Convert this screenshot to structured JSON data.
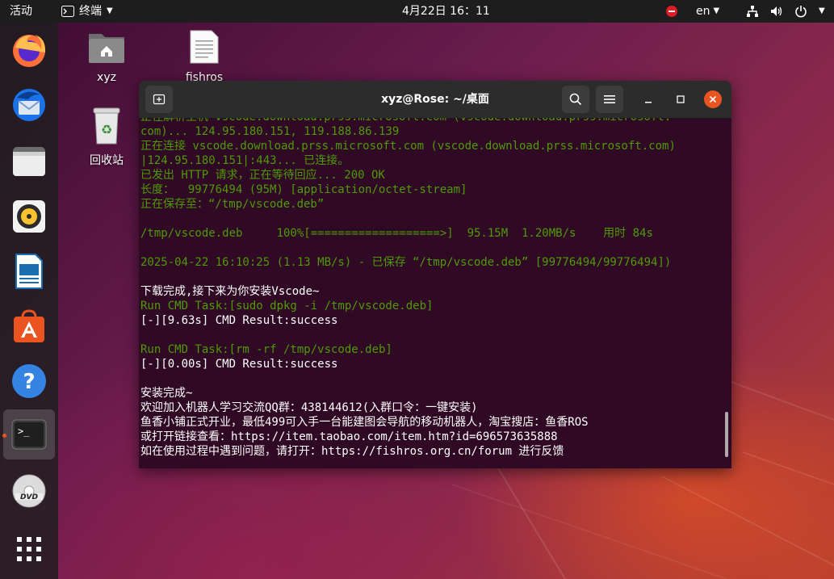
{
  "topbar": {
    "activities": "活动",
    "app_name": "终端",
    "clock": "4月22日  16：11",
    "lang": "en"
  },
  "dock": {
    "items": [
      "firefox-icon",
      "thunderbird-icon",
      "files-icon",
      "rhythmbox-icon",
      "libreoffice-writer-icon",
      "software-center-icon",
      "help-icon",
      "terminal-icon",
      "dvd-icon",
      "show-apps-icon"
    ]
  },
  "desktop": {
    "icons": [
      {
        "label": "xyz"
      },
      {
        "label": "fishros"
      },
      {
        "label": "回收站"
      }
    ]
  },
  "terminal": {
    "title": "xyz@Rose: ~/桌面",
    "lines": [
      {
        "text": "正在解析主机 vscode.download.prss.microsoft.com (vscode.download.prss.microsoft.",
        "c": "g"
      },
      {
        "text": "com)... 124.95.180.151, 119.188.86.139",
        "c": "g"
      },
      {
        "text": "正在连接 vscode.download.prss.microsoft.com (vscode.download.prss.microsoft.com)",
        "c": "g"
      },
      {
        "text": "|124.95.180.151|:443... 已连接。",
        "c": "g"
      },
      {
        "text": "已发出 HTTP 请求，正在等待回应... 200 OK",
        "c": "g"
      },
      {
        "text": "长度：  99776494 (95M) [application/octet-stream]",
        "c": "g"
      },
      {
        "text": "正在保存至：“/tmp/vscode.deb”",
        "c": "g"
      },
      {
        "text": "",
        "c": "g"
      },
      {
        "text": "/tmp/vscode.deb     100%[===================>]  95.15M  1.20MB/s    用时 84s",
        "c": "g"
      },
      {
        "text": "",
        "c": "g"
      },
      {
        "text": "2025-04-22 16:10:25 (1.13 MB/s) - 已保存 “/tmp/vscode.deb” [99776494/99776494])",
        "c": "g"
      },
      {
        "text": "",
        "c": "g"
      },
      {
        "text": "下载完成,接下来为你安装Vscode~",
        "c": "w"
      },
      {
        "text": "Run CMD Task:[sudo dpkg -i /tmp/vscode.deb]",
        "c": "g"
      },
      {
        "text": "[-][9.63s] CMD Result:success",
        "c": "w"
      },
      {
        "text": "",
        "c": "w"
      },
      {
        "text": "Run CMD Task:[rm -rf /tmp/vscode.deb]",
        "c": "g"
      },
      {
        "text": "[-][0.00s] CMD Result:success",
        "c": "w"
      },
      {
        "text": "",
        "c": "w"
      },
      {
        "text": "安装完成~",
        "c": "w"
      },
      {
        "text": "欢迎加入机器人学习交流QQ群：438144612(入群口令：一键安装)",
        "c": "w"
      },
      {
        "text": "鱼香小铺正式开业，最低499可入手一台能建图会导航的移动机器人，淘宝搜店：鱼香ROS",
        "c": "w"
      },
      {
        "text": "或打开链接查看：https://item.taobao.com/item.htm?id=696573635888",
        "c": "w"
      },
      {
        "text": "如在使用过程中遇到问题，请打开：https://fishros.org.cn/forum 进行反馈",
        "c": "w"
      }
    ]
  },
  "colors": {
    "terminal_bg": "#300a24",
    "green_text": "#4e9a06",
    "accent": "#e95420"
  }
}
